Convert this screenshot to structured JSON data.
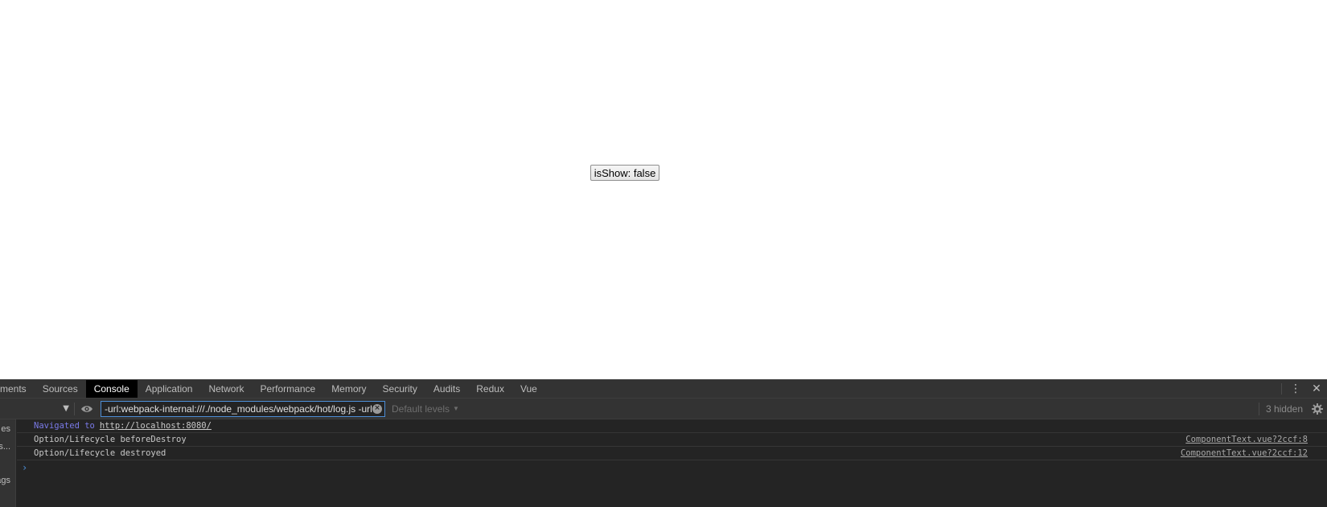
{
  "page": {
    "button_label": "isShow: false"
  },
  "devtools": {
    "tabs": [
      "ments",
      "Sources",
      "Console",
      "Application",
      "Network",
      "Performance",
      "Memory",
      "Security",
      "Audits",
      "Redux",
      "Vue"
    ],
    "active_tab": "Console",
    "menu_icon": "⋮",
    "close_icon": "✕",
    "toolbar": {
      "context_caret": "▼",
      "filter_value": "-url:webpack-internal:///./node_modules/webpack/hot/log.js -url:webpack-internal:///./node_modules/webpack-dev-server/client/index.js",
      "clear_icon": "×",
      "levels_label": "Default levels",
      "levels_caret": "▼",
      "hidden_count": "3 hidden"
    },
    "sidebar": {
      "items": [
        "es",
        "s...",
        "ags"
      ]
    },
    "console": {
      "navigated_prefix": "Navigated to",
      "navigated_url": "http://localhost:8080/",
      "messages": [
        {
          "text": "Option/Lifecycle beforeDestroy",
          "source": "ComponentText.vue?2ccf:8"
        },
        {
          "text": "Option/Lifecycle destroyed",
          "source": "ComponentText.vue?2ccf:12"
        }
      ],
      "prompt": "›"
    }
  },
  "colors": {
    "accent": "#4d8ed6",
    "panel_bg": "#242424",
    "toolbar_bg": "#333333",
    "navigated_text": "#7a7ae8"
  }
}
